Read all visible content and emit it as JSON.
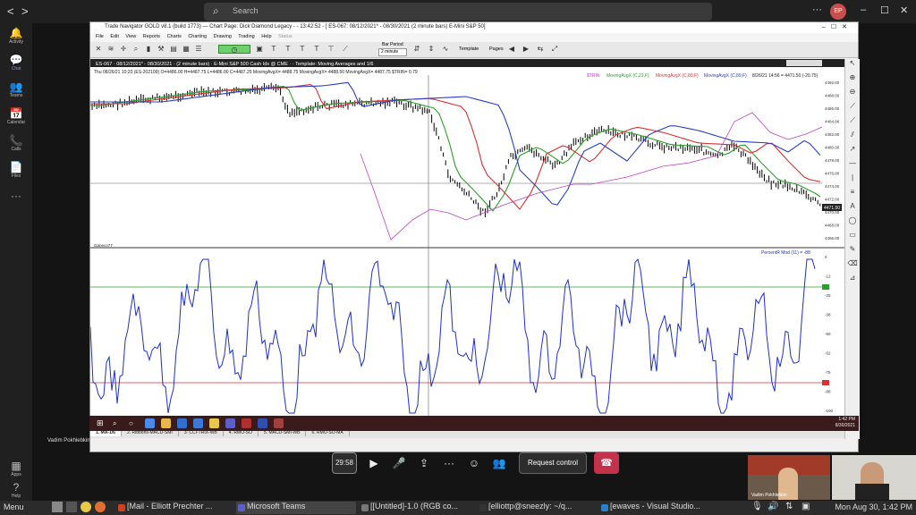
{
  "top": {
    "back": "<",
    "forward": ">",
    "search_placeholder": "Search",
    "more": "···",
    "avatar_initials": "EP",
    "win_min": "–",
    "win_max": "☐",
    "win_close": "✕"
  },
  "rail": [
    {
      "icon": "🔔",
      "label": "Activity",
      "name": "activity"
    },
    {
      "icon": "💬",
      "label": "Chat",
      "name": "chat"
    },
    {
      "icon": "👥",
      "label": "Teams",
      "name": "teams"
    },
    {
      "icon": "📅",
      "label": "Calendar",
      "name": "calendar"
    },
    {
      "icon": "📞",
      "label": "Calls",
      "name": "calls"
    },
    {
      "icon": "📄",
      "label": "Files",
      "name": "files"
    },
    {
      "icon": "···",
      "label": "",
      "name": "more"
    },
    {
      "icon": "▦",
      "label": "Apps",
      "name": "apps"
    },
    {
      "icon": "?",
      "label": "Help",
      "name": "help"
    }
  ],
  "presenter_name": "Vadim Pokhlebkin",
  "tn": {
    "title": "Trade Navigator GOLD v8.1 (build 1773)  —  Chart Page: Dick Diamond Legacy - - 13:42:52 - [ ES-067: 08/12/2021* - 08/30/2021 (2 minute bars)  E-Mini S&P 50]",
    "menu": [
      "File",
      "Edit",
      "View",
      "Reports",
      "Charts",
      "Charting",
      "Drawing",
      "Trading",
      "Help",
      "Status"
    ],
    "bar_period_label": "Bar Period",
    "bar_period_value": "2 minute",
    "template_label": "Template",
    "pages_label": "Pages",
    "chart_header": "ES-067 · 08/12/2021* - 08/30/2021 · (2 minute bars) · E-Mini S&P 500 Cash Idx @ CME · - Template: Moving Averages and 1/6",
    "ohlc_line": "Thu  08/26/21 10:20 (ES-202109)  O=4486.00  H=4487.75  L=4486.00  C=4487.25  MovingAvgX= 4488.75  MovingAvgX= 4488.50  MovingAvgX= 4487.75  $TRIN= 0.79",
    "legend": [
      "$TRIN",
      "MovingAvgX (C,21,F)",
      "MovingAvgX (C,80,F)",
      "MovingAvgX (C,89,F)",
      "8/26/21 14:56 = 4471.50 (-20.75)"
    ],
    "price_ticks": [
      "4492.00",
      "4488.00",
      "4486.00",
      "4484.00",
      "4482.00",
      "4480.00",
      "4478.00",
      "4476.00",
      "4474.00",
      "4472.00",
      "4470.00",
      "4468.00",
      "4466.00"
    ],
    "last_price": "4471.50",
    "lower_label": "PercentR Mod (11) = -88",
    "osc_ticks": [
      "0",
      "-12",
      "-25",
      "-38",
      "-50",
      "-62",
      "-75",
      "-88",
      "-100"
    ],
    "lower_left_label": "Ganeco77",
    "tabs": [
      "1. MA-1/6",
      "2. Ribbons-MACD-SMI",
      "3. CCI-TRIX-WB",
      "4. RMO-SO",
      "5. MACD-SMI-WB",
      "6. RMO-SO-MA"
    ],
    "clock_time": "1:42 PM",
    "clock_date": "8/30/2021"
  },
  "colors": {
    "ma_fast": "#2aa02a",
    "ma_mid": "#d93030",
    "ma_slow": "#2a3fbf",
    "trin": "#c040c0",
    "osc": "#1e2fcf",
    "osc_upper": "#2aa02a",
    "osc_lower": "#d93030"
  },
  "controls": {
    "timer": "29:58",
    "camera": "camera-icon",
    "mic": "mic-icon",
    "share": "share-icon",
    "more": "···",
    "request_control": "Request control"
  },
  "video": {
    "name1": "Vadim Pokhlebkin",
    "name2": ""
  },
  "linux": {
    "menu": "Menu",
    "tasks": [
      {
        "label": "[Mail - Elliott Prechter ...",
        "color": "#d04020"
      },
      {
        "label": "Microsoft Teams",
        "color": "#5b5fc7"
      },
      {
        "label": "[[Untitled]-1.0 (RGB co...",
        "color": "#777777"
      },
      {
        "label": "[elliottp@sneezly: ~/q...",
        "color": "#333333"
      },
      {
        "label": "[ewaves - Visual Studio...",
        "color": "#2a7fd0"
      }
    ],
    "clock": "Mon Aug 30, 1:42 PM"
  }
}
